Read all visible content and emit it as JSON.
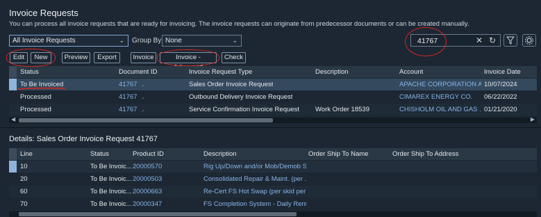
{
  "page": {
    "title": "Invoice Requests",
    "subtitle": "You can process all invoice requests that are ready for invoicing. The invoice requests can originate from predecessor documents or can be created manually."
  },
  "toolbar": {
    "view_select": "All Invoice Requests",
    "group_by_label": "Group By",
    "group_by_value": "None",
    "search_value": "41767",
    "buttons": [
      "Edit",
      "New",
      "Preview",
      "Export",
      "Invoice",
      "Invoice - Advanced",
      "Check"
    ]
  },
  "main_table": {
    "columns": [
      "Status",
      "Document ID",
      "Invoice Request Type",
      "Description",
      "Account",
      "Invoice Date"
    ],
    "rows": [
      {
        "status": "To Be Invoiced",
        "doc_id": "41767",
        "type": "Sales Order Invoice Request",
        "description": "",
        "account": "APACHE CORPORATION A...",
        "date": "10/07/2024"
      },
      {
        "status": "Processed",
        "doc_id": "41767",
        "type": "Outbound Delivery Invoice Request",
        "description": "",
        "account": "CIMAREX ENERGY CO.",
        "date": "06/22/2022"
      },
      {
        "status": "Processed",
        "doc_id": "41767",
        "type": "Service Confirmation Invoice Request",
        "description": "Work Order 18539",
        "account": "CHISHOLM OIL AND GAS ...",
        "date": "01/21/2020"
      }
    ]
  },
  "details": {
    "title": "Details: Sales Order Invoice Request 41767",
    "columns": [
      "Line",
      "Status",
      "Product ID",
      "Description",
      "Order Ship To Name",
      "Order Ship To Address"
    ],
    "rows": [
      {
        "line": "10",
        "status": "To Be Invoic...",
        "product": "20000570",
        "description": "Rig Up/Down and/or Mob/Demob S..."
      },
      {
        "line": "20",
        "status": "To Be Invoic...",
        "product": "20000503",
        "description": "Consolidated Repair & Maint. (per ..."
      },
      {
        "line": "60",
        "status": "To Be Invoic...",
        "product": "20000663",
        "description": "Re-Cert FS Hot Swap (per skid per j..."
      },
      {
        "line": "70",
        "status": "To Be Invoic...",
        "product": "20000347",
        "description": "FS Completion System - Daily Rental"
      }
    ]
  },
  "icons": {
    "view_chevron": "chevron-down-icon",
    "clear": "close-icon",
    "refresh": "refresh-icon",
    "filter": "filter-icon",
    "settings": "gear-icon"
  },
  "colors": {
    "background": "#1c2733",
    "link": "#8ab4e6",
    "annotation": "#d8261f",
    "selection": "#34495e"
  }
}
